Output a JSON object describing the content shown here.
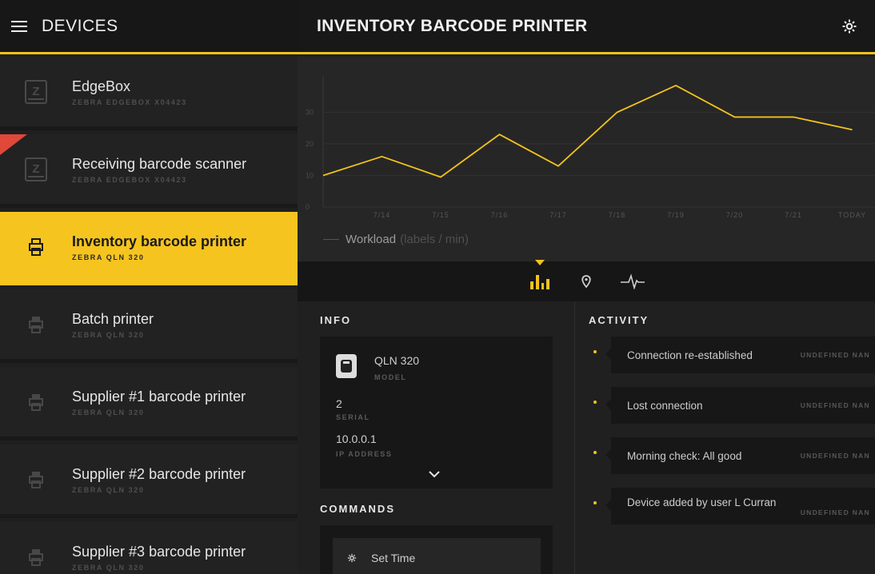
{
  "sidebar": {
    "title": "DEVICES",
    "items": [
      {
        "name": "EdgeBox",
        "model": "ZEBRA EDGEBOX X04423",
        "icon": "edgebox-icon"
      },
      {
        "name": "Receiving barcode scanner",
        "model": "ZEBRA EDGEBOX X04423",
        "icon": "edgebox-icon",
        "alert": true
      },
      {
        "name": "Inventory barcode printer",
        "model": "ZEBRA QLN 320",
        "icon": "printer-icon",
        "active": true
      },
      {
        "name": "Batch printer",
        "model": "ZEBRA QLN 320",
        "icon": "printer-icon"
      },
      {
        "name": "Supplier #1 barcode printer",
        "model": "ZEBRA QLN 320",
        "icon": "printer-icon"
      },
      {
        "name": "Supplier #2 barcode printer",
        "model": "ZEBRA QLN 320",
        "icon": "printer-icon"
      },
      {
        "name": "Supplier #3 barcode printer",
        "model": "ZEBRA QLN 320",
        "icon": "printer-icon"
      }
    ]
  },
  "header": {
    "title": "INVENTORY BARCODE PRINTER",
    "settings_icon": "gear-icon"
  },
  "chart_data": {
    "type": "line",
    "categories": [
      "",
      "7/14",
      "7/15",
      "7/16",
      "7/17",
      "7/18",
      "7/19",
      "7/20",
      "7/21",
      "TODAY",
      ""
    ],
    "series": [
      {
        "values": [
          10,
          16,
          9.5,
          23,
          13,
          30,
          38.5,
          28.5,
          28.5,
          24.5
        ]
      }
    ],
    "yticks": [
      0,
      10,
      20,
      30
    ],
    "ylim": [
      0,
      40
    ],
    "legend": {
      "label": "Workload",
      "unit": "(labels / min)"
    },
    "colors": {
      "line": "#f2c21d"
    },
    "grid": true
  },
  "tabs": [
    {
      "name": "chart",
      "icon": "bar-chart-icon",
      "active": true
    },
    {
      "name": "location",
      "icon": "location-pin-icon"
    },
    {
      "name": "activity",
      "icon": "heartbeat-icon"
    }
  ],
  "info": {
    "title": "INFO",
    "model_value": "QLN 320",
    "model_label": "MODEL",
    "serial_value": "2",
    "serial_label": "SERIAL",
    "ip_value": "10.0.0.1",
    "ip_label": "IP ADDRESS"
  },
  "commands": {
    "title": "COMMANDS",
    "items": [
      {
        "label": "Set Time",
        "icon": "gear-icon"
      }
    ]
  },
  "activity": {
    "title": "ACTIVITY",
    "items": [
      {
        "text": "Connection re-established",
        "time": "UNDEFINED NAN"
      },
      {
        "text": "Lost connection",
        "time": "UNDEFINED NAN"
      },
      {
        "text": "Morning check: All good",
        "time": "UNDEFINED NAN"
      },
      {
        "text": "Device added by user L Curran",
        "time": "UNDEFINED NAN"
      }
    ]
  },
  "colors": {
    "accent": "#f2c21d",
    "alert": "#e0483a"
  }
}
